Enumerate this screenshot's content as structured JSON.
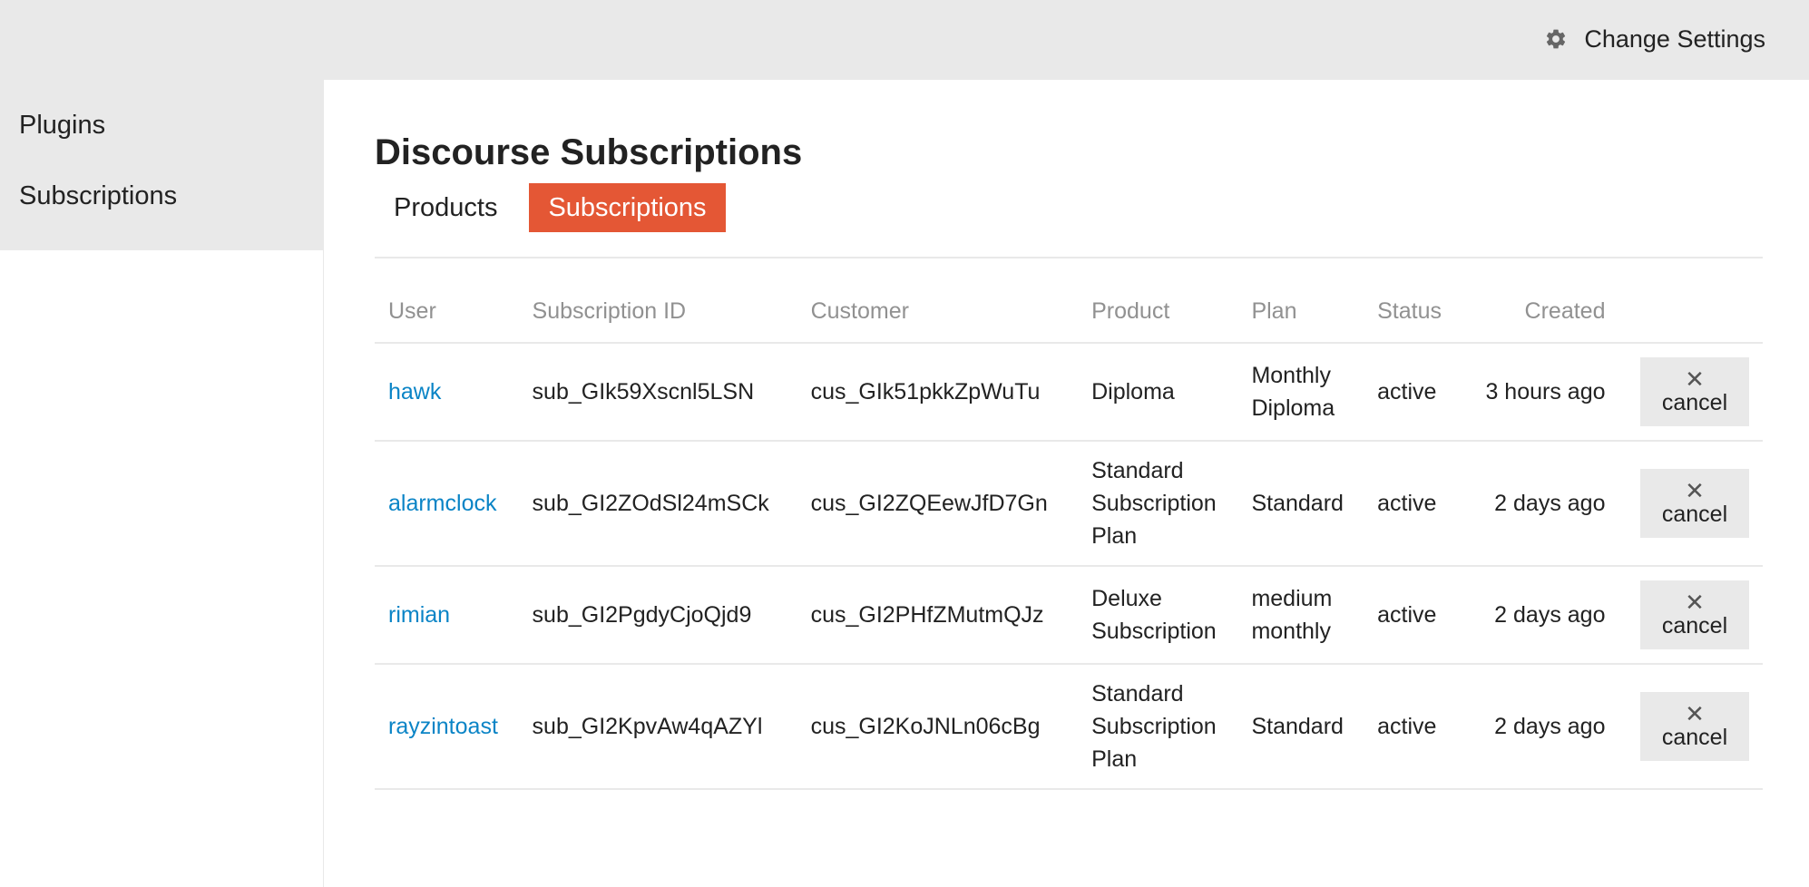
{
  "header": {
    "settings_icon": "gear-icon",
    "settings_label": "Change Settings"
  },
  "sidebar": {
    "items": [
      {
        "label": "Plugins"
      },
      {
        "label": "Subscriptions"
      }
    ]
  },
  "main": {
    "title": "Discourse Subscriptions",
    "tabs": [
      {
        "label": "Products",
        "active": false
      },
      {
        "label": "Subscriptions",
        "active": true
      }
    ],
    "table": {
      "columns": [
        "User",
        "Subscription ID",
        "Customer",
        "Product",
        "Plan",
        "Status",
        "Created"
      ],
      "rows": [
        {
          "user": "hawk",
          "subscription_id": "sub_GIk59Xscnl5LSN",
          "customer": "cus_GIk51pkkZpWuTu",
          "product": "Diploma",
          "plan": "Monthly Diploma",
          "status": "active",
          "created": "3 hours ago",
          "action": "cancel"
        },
        {
          "user": "alarmclock",
          "subscription_id": "sub_GI2ZOdSl24mSCk",
          "customer": "cus_GI2ZQEewJfD7Gn",
          "product": "Standard Subscription Plan",
          "plan": "Standard",
          "status": "active",
          "created": "2 days ago",
          "action": "cancel"
        },
        {
          "user": "rimian",
          "subscription_id": "sub_GI2PgdyCjoQjd9",
          "customer": "cus_GI2PHfZMutmQJz",
          "product": "Deluxe Subscription",
          "plan": "medium monthly",
          "status": "active",
          "created": "2 days ago",
          "action": "cancel"
        },
        {
          "user": "rayzintoast",
          "subscription_id": "sub_GI2KpvAw4qAZYl",
          "customer": "cus_GI2KoJNLn06cBg",
          "product": "Standard Subscription Plan",
          "plan": "Standard",
          "status": "active",
          "created": "2 days ago",
          "action": "cancel"
        }
      ]
    }
  },
  "colors": {
    "accent": "#e45735",
    "link": "#0a84c6",
    "panel_bg": "#e9e9e9",
    "header_text": "#919191"
  }
}
